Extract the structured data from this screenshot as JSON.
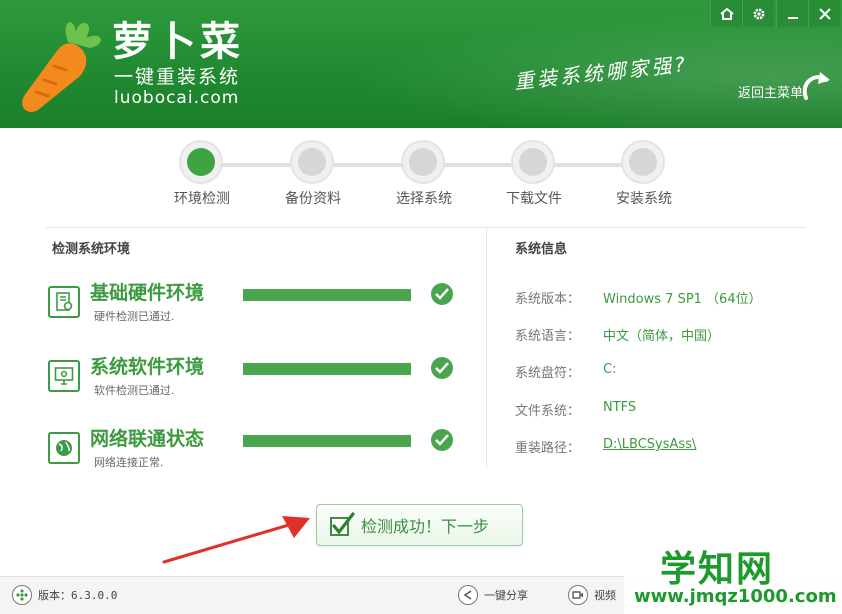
{
  "header": {
    "brand_name": "萝卜菜",
    "brand_sub": "一键重装系统",
    "brand_url": "luobocai.com",
    "slogan": "重装系统哪家强?",
    "back_menu": "返回主菜单"
  },
  "steps": [
    {
      "label": "环境检测",
      "active": true
    },
    {
      "label": "备份资料",
      "active": false
    },
    {
      "label": "选择系统",
      "active": false
    },
    {
      "label": "下载文件",
      "active": false
    },
    {
      "label": "安装系统",
      "active": false
    }
  ],
  "detect": {
    "title": "检测系统环境",
    "items": [
      {
        "title": "基础硬件环境",
        "sub": "硬件检测已通过.",
        "progress": 1.0
      },
      {
        "title": "系统软件环境",
        "sub": "软件检测已通过.",
        "progress": 1.0
      },
      {
        "title": "网络联通状态",
        "sub": "网络连接正常.",
        "progress": 1.0
      }
    ]
  },
  "sysinfo": {
    "title": "系统信息",
    "rows": [
      {
        "label": "系统版本：",
        "value": "Windows 7 SP1 （64位）"
      },
      {
        "label": "系统语言：",
        "value": "中文（简体，中国）"
      },
      {
        "label": "系统盘符：",
        "value": "C:"
      },
      {
        "label": "文件系统：",
        "value": "NTFS"
      },
      {
        "label": "重装路径：",
        "value": "D:\\LBCSysAss\\"
      }
    ]
  },
  "next_button": "检测成功！下一步",
  "footer": {
    "version": "版本：6.3.0.0",
    "share": "一键分享",
    "video": "视频"
  },
  "watermark": {
    "big": "学知网",
    "small": "www.jmqz1000.com"
  },
  "colors": {
    "brand_green": "#218a31",
    "accent_green": "#4aa54e",
    "arrow_red": "#e0302a"
  }
}
